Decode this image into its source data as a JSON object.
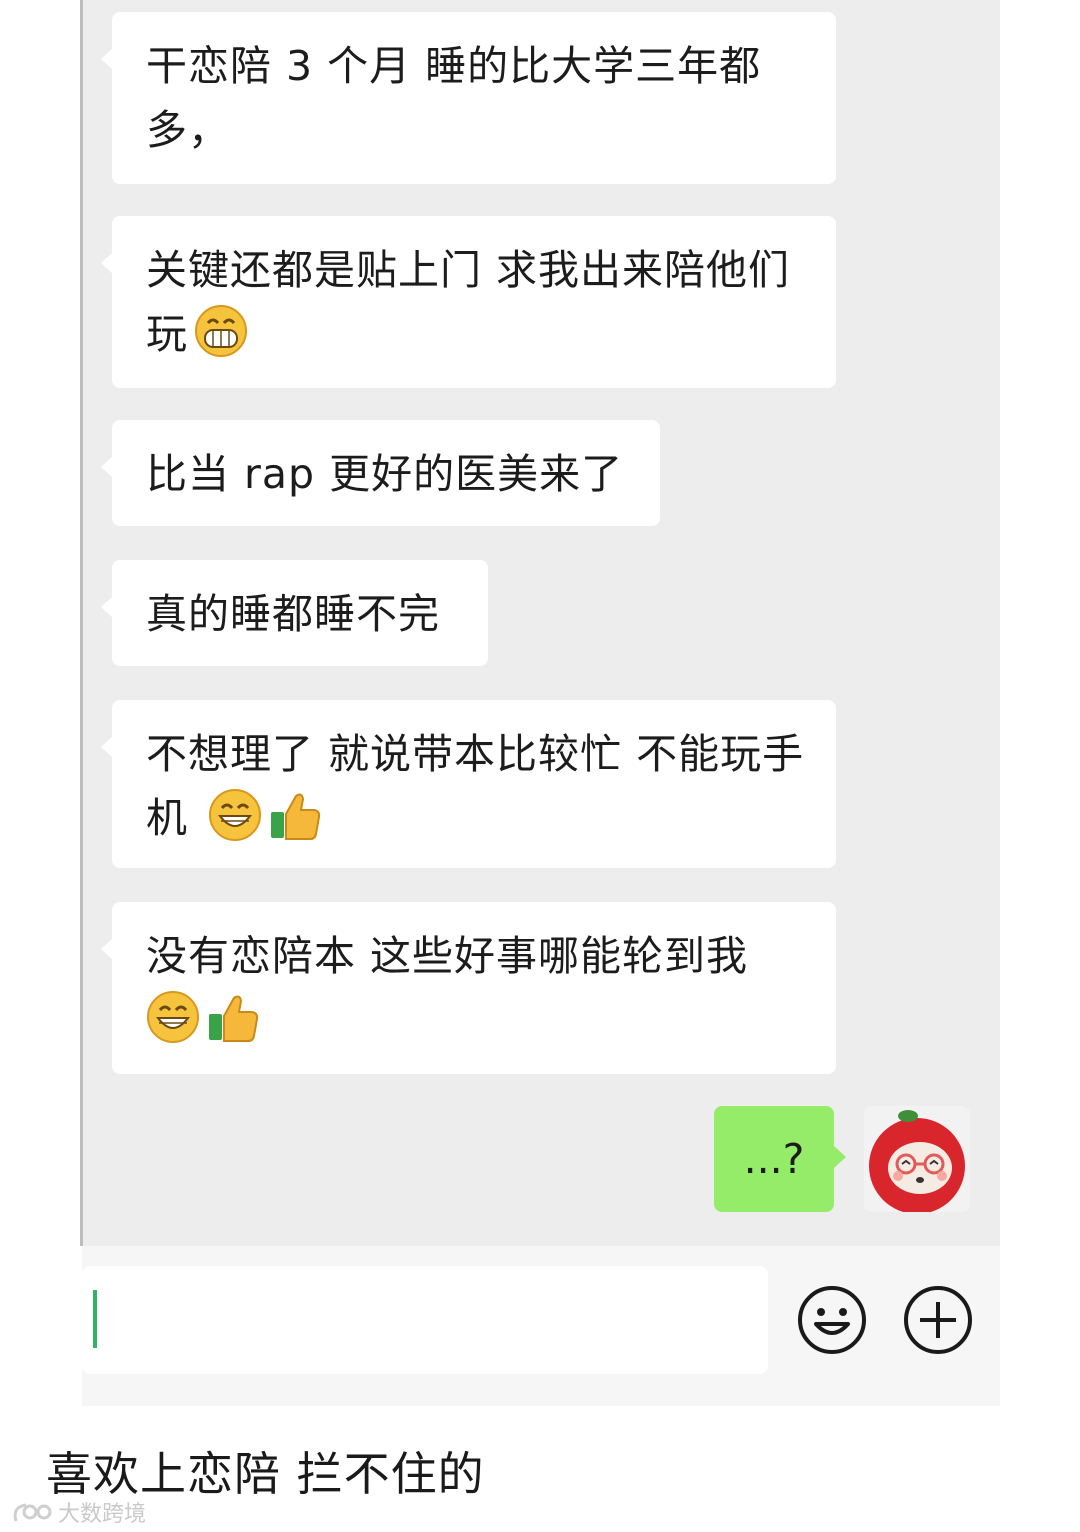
{
  "chat": {
    "messages": [
      {
        "text": "干恋陪 3 个月 睡的比大学三年都多，",
        "emoji": []
      },
      {
        "text": "关键还都是贴上门 求我出来陪他们玩",
        "emoji": [
          "grin-icon"
        ]
      },
      {
        "text": "比当 rap 更好的医美来了",
        "emoji": []
      },
      {
        "text": "真的睡都睡不完",
        "emoji": []
      },
      {
        "text": "不想理了 就说带本比较忙 不能玩手机 ",
        "emoji": [
          "smile-icon",
          "thumbs-up-icon"
        ]
      },
      {
        "text": "没有恋陪本 这些好事哪能轮到我",
        "emoji": [
          "smile-icon",
          "thumbs-up-icon"
        ]
      }
    ],
    "outgoing": {
      "text": "...?"
    }
  },
  "input_bar": {
    "value": "",
    "icons": [
      "emoji-button-icon",
      "plus-icon"
    ]
  },
  "caption": "喜欢上恋陪 拦不住的",
  "watermark": "大数跨境",
  "colors": {
    "chat_bg": "#ededed",
    "incoming_bubble": "#ffffff",
    "outgoing_bubble": "#95ec69",
    "cursor": "#2fb463"
  }
}
